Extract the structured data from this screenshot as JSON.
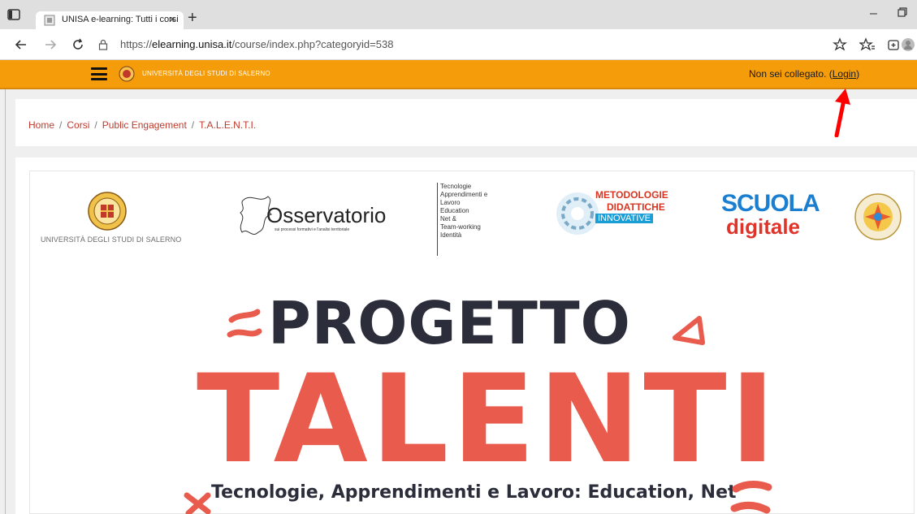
{
  "browser": {
    "tab_title": "UNISA e-learning: Tutti i corsi",
    "url_prefix": "https://",
    "url_host": "elearning.unisa.it",
    "url_path": "/course/index.php?categoryid=538"
  },
  "header": {
    "brand": "UNIVERSITÀ DEGLI STUDI DI SALERNO",
    "not_logged_text": "Non sei collegato. (",
    "login_label": "Login",
    "login_close": ")"
  },
  "breadcrumb": {
    "items": [
      "Home",
      "Corsi",
      "Public Engagement",
      "T.A.L.E.N.T.I."
    ],
    "separator": "/"
  },
  "logos": {
    "unisa_text": "UNIVERSITÀ DEGLI STUDI DI SALERNO",
    "osservatorio_word": "Osservatorio",
    "osservatorio_sub": "sui processi formativi e l'analisi territoriale",
    "talenti_lines": [
      "Tecnologie",
      "Apprendimenti e",
      "Lavoro",
      "Education",
      "Net &",
      "Team-working",
      "Identità"
    ],
    "metodologie_l1": "METODOLOGIE",
    "metodologie_l2": "DIDATTICHE",
    "metodologie_l3": "INNOVATIVE",
    "scuola_l1": "SCUOLA",
    "scuola_l2": "digitale"
  },
  "hero": {
    "progetto": "PROGETTO",
    "talenti": "TALENTI",
    "subtitle": "Tecnologie, Apprendimenti e Lavoro: Education, Net"
  },
  "colors": {
    "header_bg": "#f59c0b",
    "breadcrumb_link": "#c0392b",
    "talenti_red": "#e85b4d",
    "dark_text": "#2b2d3a",
    "arrow": "#ff0000"
  }
}
